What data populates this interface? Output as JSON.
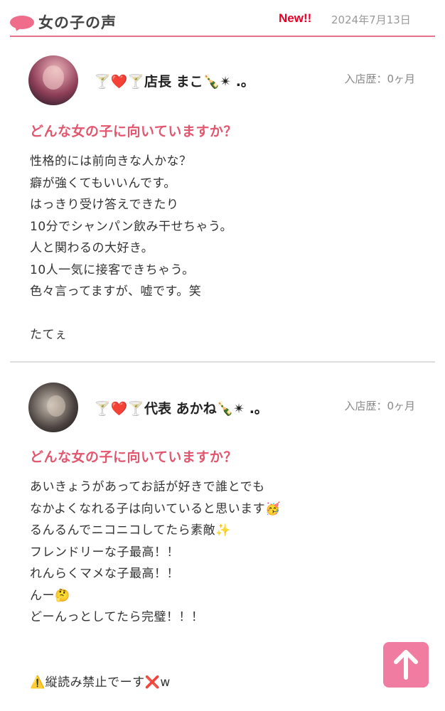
{
  "header": {
    "title": "女の子の声",
    "new_badge": "New!!",
    "date": "2024年7月13日"
  },
  "posts": [
    {
      "name": "🍸❤️🍸店長 まこ🍾✴ .｡",
      "tenure": "入店歴：0ヶ月",
      "question": "どんな女の子に向いていますか？",
      "lines": [
        "性格的には前向きな人かな？",
        "癖が強くてもいいんです。",
        "はっきり受け答えできたり",
        "10分でシャンパン飲み干せちゃう。",
        "人と関わるの大好き。",
        "10人一気に接客できちゃう。",
        "色々言ってますが、嘘です。笑",
        "",
        "たてぇ"
      ]
    },
    {
      "name": "🍸❤️🍸代表 あかね🍾✴ .｡",
      "tenure": "入店歴：0ヶ月",
      "question": "どんな女の子に向いていますか？",
      "lines": [
        "あいきょうがあってお話が好きで誰とでも",
        "なかよくなれる子は向いていると思います🥳",
        "るんるんでニコニコしてたら素敵✨",
        "フレンドリーな子最高！！",
        "れんらくマメな子最高！！",
        "んー🤔",
        "どーんっとしてたら完璧！！！",
        "",
        "",
        "⚠️縦読み禁止でーす❌w"
      ]
    }
  ],
  "scroll_top": {
    "icon": "arrow-up-icon",
    "color": "#f17ca1"
  },
  "colors": {
    "accent": "#e9708c",
    "question": "#e2566e",
    "new_badge": "#e60026"
  }
}
